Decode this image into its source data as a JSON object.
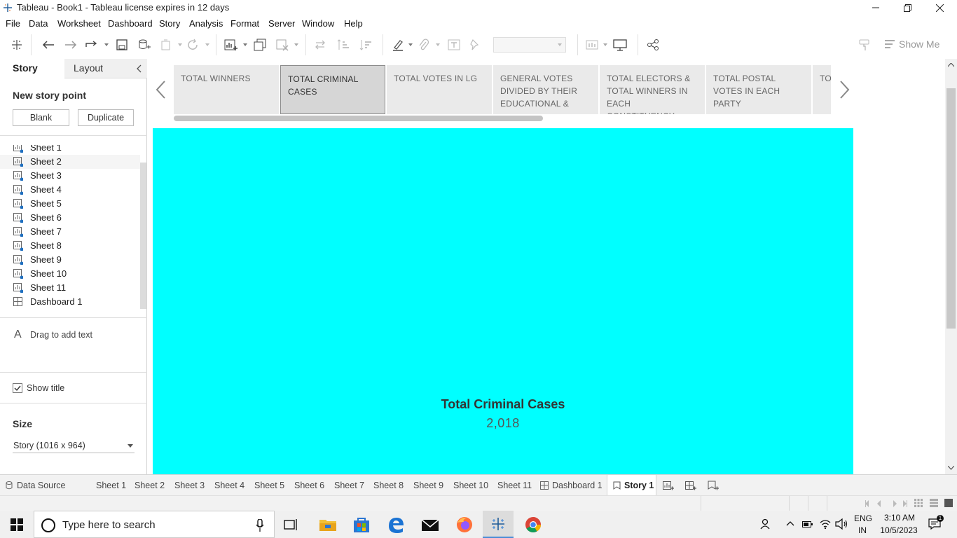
{
  "window": {
    "title": "Tableau - Book1 - Tableau license expires in 12 days"
  },
  "menu": [
    "File",
    "Data",
    "Worksheet",
    "Dashboard",
    "Story",
    "Analysis",
    "Format",
    "Server",
    "Window",
    "Help"
  ],
  "toolbar": {
    "show_me": "Show Me"
  },
  "left_pane": {
    "tabs": {
      "story": "Story",
      "layout": "Layout"
    },
    "new_story_point": "New story point",
    "blank_button": "Blank",
    "duplicate_button": "Duplicate",
    "items": [
      {
        "label": "Sheet 1",
        "type": "sheet"
      },
      {
        "label": "Sheet 2",
        "type": "sheet"
      },
      {
        "label": "Sheet 3",
        "type": "sheet"
      },
      {
        "label": "Sheet 4",
        "type": "sheet"
      },
      {
        "label": "Sheet 5",
        "type": "sheet"
      },
      {
        "label": "Sheet 6",
        "type": "sheet"
      },
      {
        "label": "Sheet 7",
        "type": "sheet"
      },
      {
        "label": "Sheet 8",
        "type": "sheet"
      },
      {
        "label": "Sheet 9",
        "type": "sheet"
      },
      {
        "label": "Sheet 10",
        "type": "sheet"
      },
      {
        "label": "Sheet 11",
        "type": "sheet"
      },
      {
        "label": "Dashboard 1",
        "type": "dashboard"
      }
    ],
    "drag_text": "Drag to add text",
    "show_title": "Show title",
    "show_title_checked": true,
    "size_heading": "Size",
    "size_value": "Story (1016 x 964)"
  },
  "story_points": [
    {
      "label": "TOTAL WINNERS",
      "active": false
    },
    {
      "label": "TOTAL CRIMINAL CASES",
      "active": true
    },
    {
      "label": "TOTAL VOTES IN LG",
      "active": false
    },
    {
      "label": "GENERAL VOTES DIVIDED BY THEIR EDUCATIONAL &",
      "active": false
    },
    {
      "label": "TOTAL ELECTORS & TOTAL WINNERS IN EACH CONSTITUENCY",
      "active": false
    },
    {
      "label": "TOTAL POSTAL VOTES IN EACH PARTY",
      "active": false
    },
    {
      "label": "TO STA",
      "active": false
    }
  ],
  "story_canvas": {
    "background": "#00FFFF",
    "kpi_title": "Total Criminal Cases",
    "kpi_value": "2,018"
  },
  "sheet_tabs": {
    "data_source": "Data Source",
    "tabs": [
      "Sheet 1",
      "Sheet 2",
      "Sheet 3",
      "Sheet 4",
      "Sheet 5",
      "Sheet 6",
      "Sheet 7",
      "Sheet 8",
      "Sheet 9",
      "Sheet 10",
      "Sheet 11"
    ],
    "dashboard": "Dashboard 1",
    "story": "Story 1"
  },
  "taskbar": {
    "search_placeholder": "Type here to search",
    "lang": "ENG",
    "region": "IN",
    "time": "3:10 AM",
    "date": "10/5/2023"
  }
}
